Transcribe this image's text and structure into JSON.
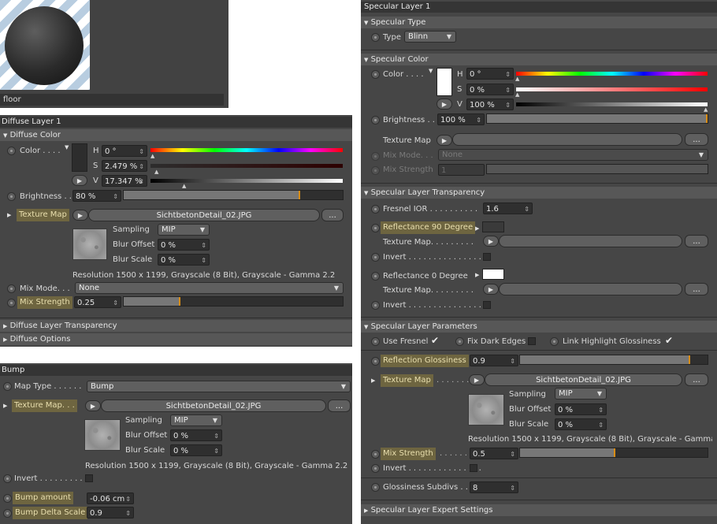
{
  "preview": {
    "material_name": "floor"
  },
  "diffuse": {
    "title": "Diffuse Layer 1",
    "color_section": "Diffuse Color",
    "color_label": "Color . . . .",
    "h_label": "H",
    "h_value": "0 °",
    "s_label": "S",
    "s_value": "2.479 %",
    "v_label": "V",
    "v_value": "17.347 %",
    "brightness_label": "Brightness . .",
    "brightness_value": "80 %",
    "brightness_level": 0.8,
    "texture_map_label": "Texture Map",
    "texture_file": "SichtbetonDetail_02.JPG",
    "more_label": "...",
    "sampling_label": "Sampling",
    "sampling_value": "MIP",
    "blur_offset_label": "Blur Offset",
    "blur_offset_value": "0 %",
    "blur_scale_label": "Blur Scale",
    "blur_scale_value": "0 %",
    "resolution": "Resolution 1500 x 1199, Grayscale (8 Bit), Grayscale - Gamma 2.2",
    "mix_mode_label": "Mix Mode. . .",
    "mix_mode_value": "None",
    "mix_strength_label": "Mix Strength",
    "mix_strength_value": "0.25",
    "mix_strength_level": 0.25,
    "transparency_section": "Diffuse Layer Transparency",
    "options_section": "Diffuse Options"
  },
  "bump": {
    "title": "Bump",
    "map_type_label": "Map Type . . . . . .",
    "map_type_value": "Bump",
    "texture_map_label": "Texture Map. . .",
    "texture_file": "SichtbetonDetail_02.JPG",
    "more_label": "...",
    "sampling_label": "Sampling",
    "sampling_value": "MIP",
    "blur_offset_label": "Blur Offset",
    "blur_offset_value": "0 %",
    "blur_scale_label": "Blur Scale",
    "blur_scale_value": "0 %",
    "resolution": "Resolution 1500 x 1199, Grayscale (8 Bit), Grayscale - Gamma 2.2",
    "invert_label": "Invert . . . . . . . . . .",
    "bump_amount_label": "Bump amount",
    "bump_amount_value": "-0.06 cm",
    "bump_delta_label": "Bump Delta Scale",
    "bump_delta_value": "0.9"
  },
  "specular": {
    "title": "Specular Layer 1",
    "type_section": "Specular Type",
    "type_label": "Type",
    "type_value": "Blinn",
    "color_section": "Specular Color",
    "color_label": "Color . . . .",
    "h_label": "H",
    "h_value": "0 °",
    "s_label": "S",
    "s_value": "0 %",
    "v_label": "V",
    "v_value": "100 %",
    "brightness_label": "Brightness . .",
    "brightness_value": "100 %",
    "brightness_level": 1.0,
    "texture_map_label": "Texture Map",
    "mix_mode_label": "Mix Mode. . .",
    "mix_mode_value": "None",
    "mix_strength_label": "Mix Strength",
    "mix_strength_value": "1",
    "more_label": "...",
    "transparency_section": "Specular Layer Transparency",
    "fresnel_ior_label": "Fresnel IOR . . . . . . . . . .",
    "fresnel_ior_value": "1.6",
    "refl90_label": "Reflectance 90 Degree",
    "tex_map_label_1": "Texture Map. . . . . . . . .",
    "invert_label_1": "Invert . . . . . . . . . . . . . . .",
    "refl0_label": "Reflectance   0 Degree",
    "tex_map_label_2": "Texture Map. . . . . . . . .",
    "invert_label_2": "Invert . . . . . . . . . . . . . . .",
    "params_section": "Specular Layer Parameters",
    "use_fresnel_label": "Use Fresnel",
    "fix_dark_label": "Fix Dark Edges",
    "link_gloss_label": "Link Highlight Glossiness",
    "refl_gloss_label": "Reflection Glossiness",
    "refl_gloss_value": "0.9",
    "refl_gloss_level": 0.9,
    "texture_map_label_p": "Texture Map",
    "texture_file": "SichtbetonDetail_02.JPG",
    "sampling_label": "Sampling",
    "sampling_value": "MIP",
    "blur_offset_label": "Blur Offset",
    "blur_offset_value": "0 %",
    "blur_scale_label": "Blur Scale",
    "blur_scale_value": "0 %",
    "resolution": "Resolution 1500 x 1199, Grayscale (8 Bit), Grayscale - Gamma 2.2",
    "mix_strength_p_label": "Mix Strength",
    "mix_strength_p_value": "0.5",
    "mix_strength_p_level": 0.5,
    "invert_label_3": "Invert . . . . . . . . . . . . . . .",
    "gloss_subdivs_label": "Glossiness Subdivs . .",
    "gloss_subdivs_value": "8",
    "expert_section": "Specular Layer Expert Settings"
  },
  "colors": {
    "panel": "#464646",
    "header": "#353535",
    "section": "#575757",
    "highlight": "#6e6540",
    "accent": "#d88c14"
  },
  "icons": {
    "radio": "radio-dot-icon",
    "arrow": "arrow-right-icon",
    "spinner": "spinner-icon",
    "expand": "triangle-icon"
  }
}
